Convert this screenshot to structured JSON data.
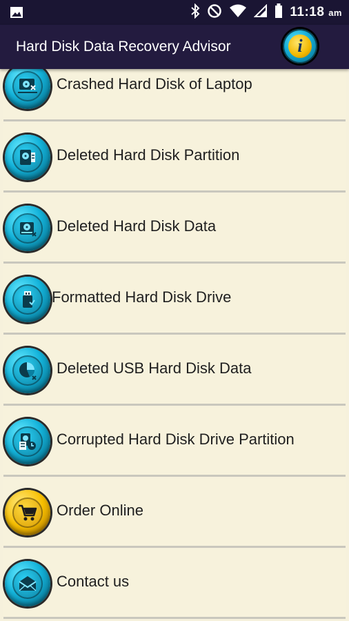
{
  "status_bar": {
    "time": "11:18",
    "ampm": "am",
    "icons": [
      "image-icon",
      "bluetooth-icon",
      "do-not-disturb-icon",
      "wifi-icon",
      "signal-icon",
      "battery-icon"
    ]
  },
  "app_bar": {
    "title": "Hard Disk Data Recovery Advisor",
    "info_glyph": "i"
  },
  "colors": {
    "app_bar_bg": "#231b3f",
    "list_bg": "#f6f1dc",
    "icon_blue": "#14b3da",
    "icon_gold": "#f7bf00"
  },
  "menu": {
    "items": [
      {
        "label": "Crashed Hard Disk of Laptop",
        "icon": "laptop-disk-icon"
      },
      {
        "label": "Deleted Hard Disk Partition",
        "icon": "partition-disk-icon"
      },
      {
        "label": "Deleted Hard Disk Data",
        "icon": "hard-disk-delete-icon"
      },
      {
        "label": "Formatted Hard Disk Drive",
        "icon": "usb-drive-icon"
      },
      {
        "label": "Deleted USB Hard Disk Data",
        "icon": "pie-disk-icon"
      },
      {
        "label": "Corrupted Hard Disk Drive Partition",
        "icon": "corrupted-disk-icon"
      },
      {
        "label": "Order Online",
        "icon": "shopping-cart-icon"
      },
      {
        "label": "Contact us",
        "icon": "mail-icon"
      }
    ]
  }
}
